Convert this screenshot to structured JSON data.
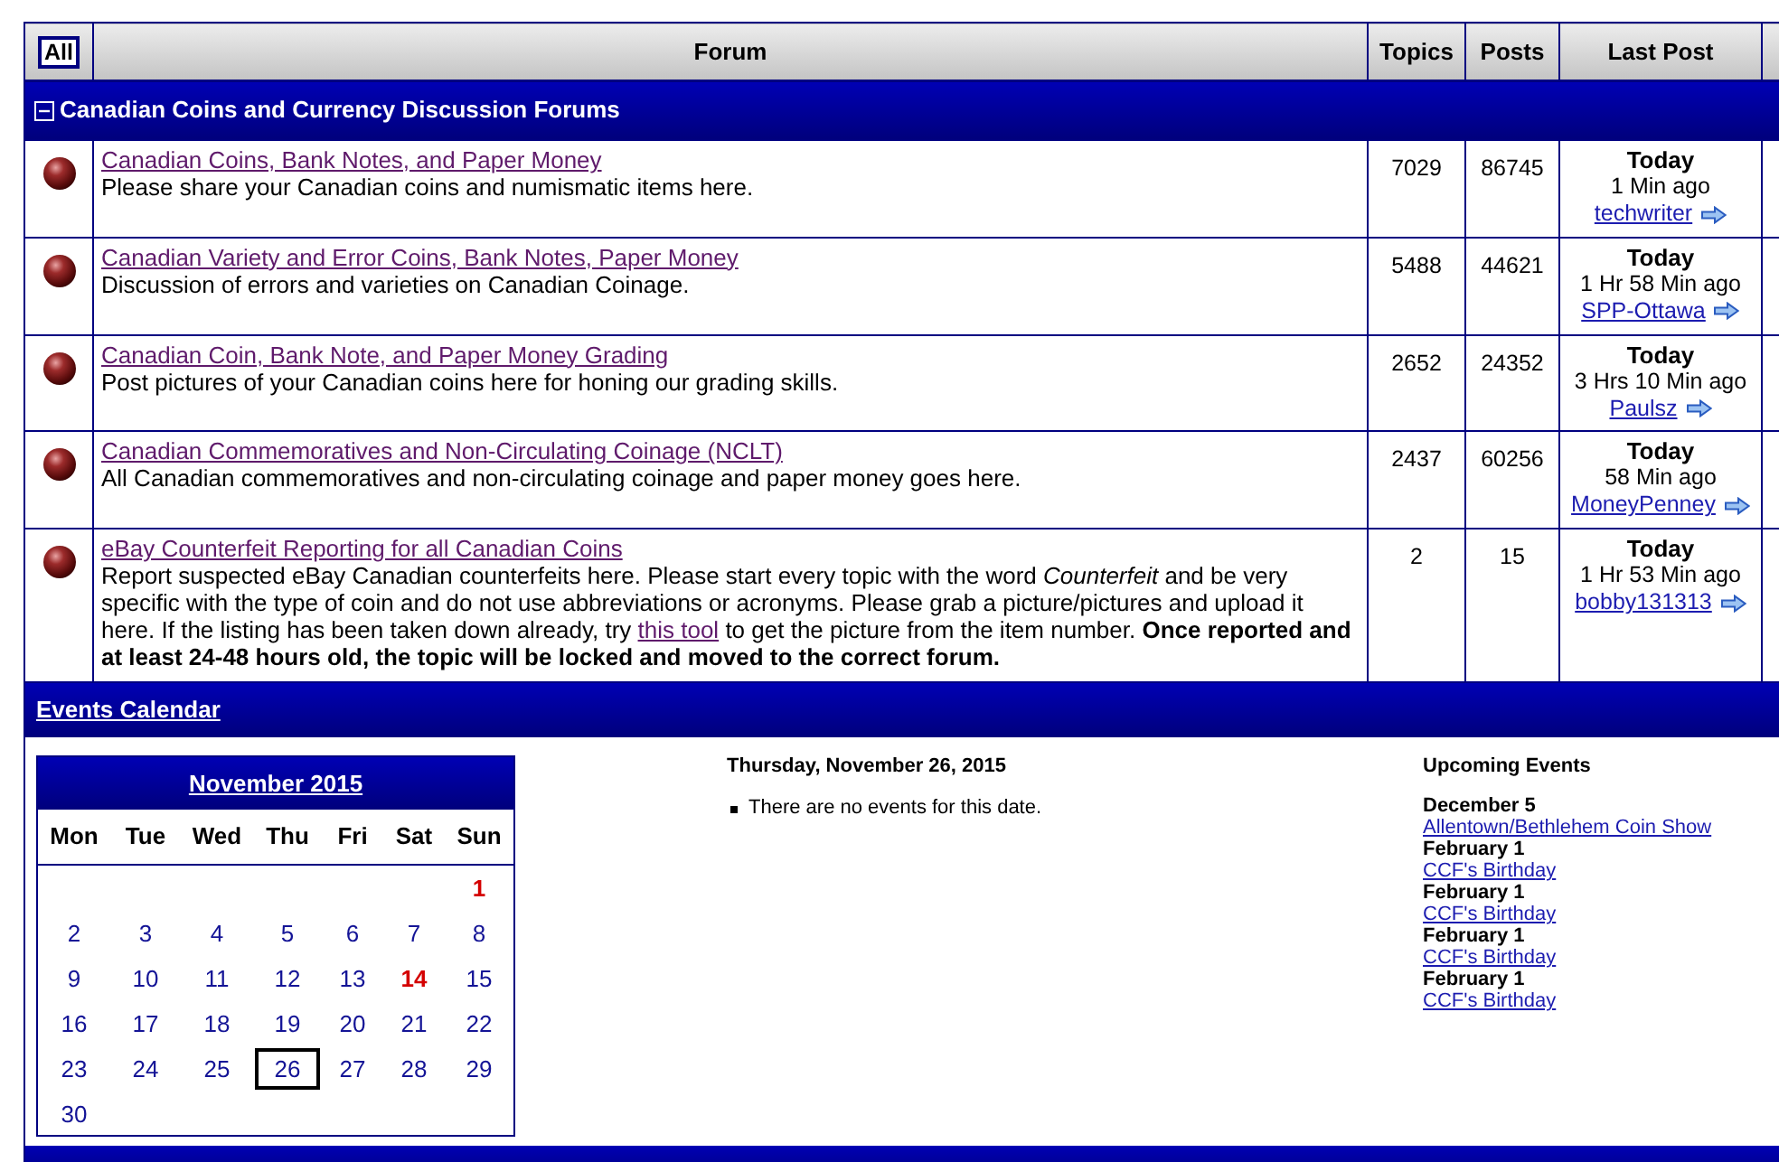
{
  "forum_table": {
    "all_button": "All",
    "columns": [
      "Forum",
      "Topics",
      "Posts",
      "Last Post"
    ],
    "category": {
      "title": "Canadian Coins and Currency Discussion Forums",
      "expanded": true
    },
    "forums": [
      {
        "title": "Canadian Coins, Bank Notes, and Paper Money",
        "description": [
          {
            "kind": "text",
            "text": "Please share your Canadian coins and numismatic items here."
          }
        ],
        "topics": "7029",
        "posts": "86745",
        "last_post": {
          "day": "Today",
          "ago": "1 Min ago",
          "user": "techwriter"
        }
      },
      {
        "title": "Canadian Variety and Error Coins, Bank Notes, Paper Money",
        "description": [
          {
            "kind": "text",
            "text": "Discussion of errors and varieties on Canadian Coinage."
          }
        ],
        "topics": "5488",
        "posts": "44621",
        "last_post": {
          "day": "Today",
          "ago": "1 Hr 58 Min ago",
          "user": "SPP-Ottawa"
        }
      },
      {
        "title": "Canadian Coin, Bank Note, and Paper Money Grading",
        "description": [
          {
            "kind": "text",
            "text": "Post pictures of your Canadian coins here for honing our grading skills."
          }
        ],
        "topics": "2652",
        "posts": "24352",
        "last_post": {
          "day": "Today",
          "ago": "3 Hrs 10 Min ago",
          "user": "Paulsz"
        }
      },
      {
        "title": "Canadian Commemoratives and Non-Circulating Coinage (NCLT)",
        "description": [
          {
            "kind": "text",
            "text": "All Canadian commemoratives and non-circulating coinage and paper money goes here."
          }
        ],
        "topics": "2437",
        "posts": "60256",
        "last_post": {
          "day": "Today",
          "ago": "58 Min ago",
          "user": "MoneyPenney"
        }
      },
      {
        "title": "eBay Counterfeit Reporting for all Canadian Coins",
        "description": [
          {
            "kind": "text",
            "text": "Report suspected eBay Canadian counterfeits here. Please start every topic with the word "
          },
          {
            "kind": "italic",
            "text": "Counterfeit"
          },
          {
            "kind": "text",
            "text": " and be very specific with the type of coin and do not use abbreviations or acronyms. Please grab a picture/pictures and upload it here. If the listing has been taken down already, try "
          },
          {
            "kind": "link",
            "text": "this tool"
          },
          {
            "kind": "text",
            "text": " to get the picture from the item number. "
          },
          {
            "kind": "bold",
            "text": "Once reported and at least 24-48 hours old, the topic will be locked and moved to the correct forum."
          }
        ],
        "topics": "2",
        "posts": "15",
        "last_post": {
          "day": "Today",
          "ago": "1 Hr 53 Min ago",
          "user": "bobby131313"
        }
      }
    ]
  },
  "events": {
    "title": "Events Calendar",
    "calendar": {
      "month": "November 2015",
      "weekdays": [
        "Mon",
        "Tue",
        "Wed",
        "Thu",
        "Fri",
        "Sat",
        "Sun"
      ],
      "weeks": [
        {
          "days": [
            {
              "day": "1",
              "kind": "event",
              "selected": false
            }
          ]
        },
        {
          "days": [
            {
              "day": "2",
              "kind": "plain",
              "selected": false
            },
            {
              "day": "3",
              "kind": "plain",
              "selected": false
            },
            {
              "day": "4",
              "kind": "plain",
              "selected": false
            },
            {
              "day": "5",
              "kind": "plain",
              "selected": false
            },
            {
              "day": "6",
              "kind": "plain",
              "selected": false
            },
            {
              "day": "7",
              "kind": "plain",
              "selected": false
            },
            {
              "day": "8",
              "kind": "plain",
              "selected": false
            }
          ]
        },
        {
          "days": [
            {
              "day": "9",
              "kind": "plain",
              "selected": false
            },
            {
              "day": "10",
              "kind": "plain",
              "selected": false
            },
            {
              "day": "11",
              "kind": "plain",
              "selected": false
            },
            {
              "day": "12",
              "kind": "plain",
              "selected": false
            },
            {
              "day": "13",
              "kind": "plain",
              "selected": false
            },
            {
              "day": "14",
              "kind": "event",
              "selected": false
            },
            {
              "day": "15",
              "kind": "plain",
              "selected": false
            }
          ]
        },
        {
          "days": [
            {
              "day": "16",
              "kind": "plain",
              "selected": false
            },
            {
              "day": "17",
              "kind": "plain",
              "selected": false
            },
            {
              "day": "18",
              "kind": "plain",
              "selected": false
            },
            {
              "day": "19",
              "kind": "plain",
              "selected": false
            },
            {
              "day": "20",
              "kind": "plain",
              "selected": false
            },
            {
              "day": "21",
              "kind": "plain",
              "selected": false
            },
            {
              "day": "22",
              "kind": "plain",
              "selected": false
            }
          ]
        },
        {
          "days": [
            {
              "day": "23",
              "kind": "plain",
              "selected": false
            },
            {
              "day": "24",
              "kind": "plain",
              "selected": false
            },
            {
              "day": "25",
              "kind": "plain",
              "selected": false
            },
            {
              "day": "26",
              "kind": "plain",
              "selected": true
            },
            {
              "day": "27",
              "kind": "plain",
              "selected": false
            },
            {
              "day": "28",
              "kind": "plain",
              "selected": false
            },
            {
              "day": "29",
              "kind": "plain",
              "selected": false
            }
          ]
        },
        {
          "days": [
            {
              "day": "30",
              "kind": "plain",
              "selected": false
            }
          ]
        }
      ]
    },
    "day_view": {
      "date": "Thursday, November 26, 2015",
      "items": [
        "There are no events for this date."
      ]
    },
    "upcoming": {
      "title": "Upcoming Events",
      "events": [
        {
          "date": "December 5",
          "name": "Allentown/Bethlehem Coin Show"
        },
        {
          "date": "February 1",
          "name": "CCF's Birthday"
        },
        {
          "date": "February 1",
          "name": "CCF's Birthday"
        },
        {
          "date": "February 1",
          "name": "CCF's Birthday"
        },
        {
          "date": "February 1",
          "name": "CCF's Birthday"
        }
      ]
    }
  }
}
